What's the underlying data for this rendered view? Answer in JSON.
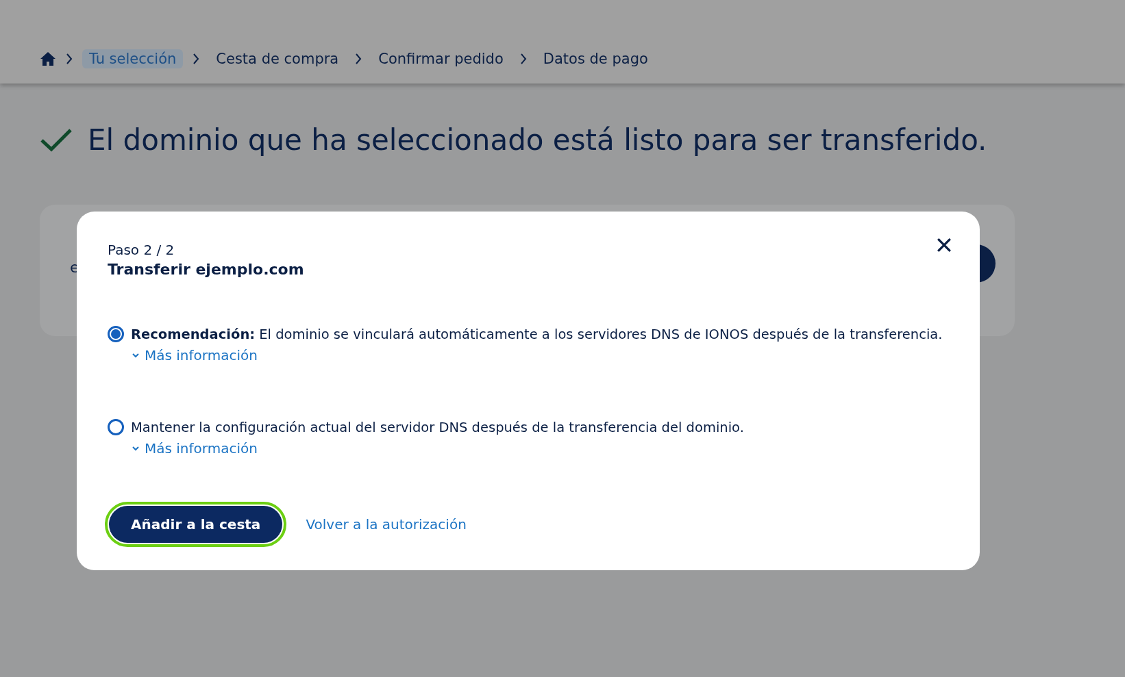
{
  "breadcrumb": [
    {
      "label": "Tu selección",
      "selected": true
    },
    {
      "label": "Cesta de compra",
      "selected": false
    },
    {
      "label": "Confirmar pedido",
      "selected": false
    },
    {
      "label": "Datos de pago",
      "selected": false
    }
  ],
  "heading": "El dominio que ha seleccionado está listo para ser transferido.",
  "card": {
    "text": "e"
  },
  "modal": {
    "step": "Paso 2 / 2",
    "title": "Transferir ejemplo.com",
    "options": [
      {
        "label": "**Recomendación:** El dominio se vinculará automáticamente a los servidores DNS de IONOS después de la transferencia.",
        "selected": true,
        "more": {
          "label": "Más información",
          "expanded": false
        }
      },
      {
        "label": "Mantener la configuración actual del servidor DNS después de la transferencia del dominio.",
        "selected": false,
        "more": {
          "label": "Más información",
          "expanded": false
        }
      }
    ],
    "primary_button": {
      "label": "Añadir a la cesta",
      "focused": true
    },
    "back_link": "Volver a la autorización"
  }
}
